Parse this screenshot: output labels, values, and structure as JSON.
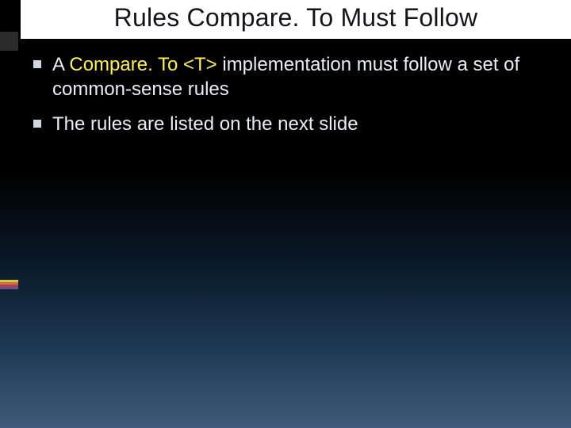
{
  "title": "Rules Compare. To Must Follow",
  "bullets": [
    {
      "pre": "A ",
      "highlight": "Compare. To <T>",
      "post": " implementation must follow a set of common-sense rules"
    },
    {
      "pre": "The rules are listed on the next slide",
      "highlight": "",
      "post": ""
    }
  ]
}
